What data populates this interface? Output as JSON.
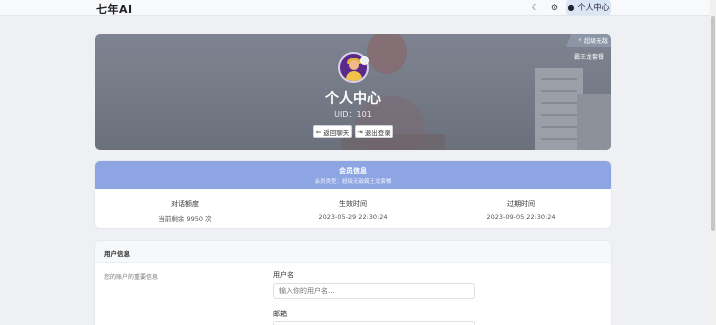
{
  "header": {
    "brand": "七年AI",
    "icons": {
      "theme": "moon-icon",
      "settings": "gear-icon",
      "user": "user-icon"
    },
    "user_center_label": "个人中心"
  },
  "profile": {
    "title": "个人中心",
    "uid": "UID：101",
    "back_label": "返回聊天",
    "logout_label": "退出登录",
    "vip_badge": "超级无敌",
    "vip_sub": "霸王龙套餐"
  },
  "membership": {
    "title": "会员信息",
    "subtitle": "会员类型：超级无敌霸王龙套餐",
    "stats": [
      {
        "label": "对话额度",
        "value": "当前剩余 9950 次"
      },
      {
        "label": "生效时间",
        "value": "2023-05-29 22:30:24"
      },
      {
        "label": "过期时间",
        "value": "2023-09-05 22:30:24"
      }
    ]
  },
  "user_info": {
    "title": "用户信息",
    "description": "您的账户的重要信息",
    "username_label": "用户名",
    "username_placeholder": "输入你的用户名...",
    "email_label": "邮箱"
  },
  "colors": {
    "accent": "#dbe6f5",
    "membership_header": "#8da5e2",
    "hero_bg": "#767c87"
  }
}
